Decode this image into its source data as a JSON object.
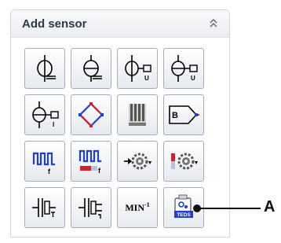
{
  "panel": {
    "title": "Add sensor"
  },
  "buttons": {
    "min_label": "MIN",
    "min_exp": "-1",
    "teds_label": "TEDS",
    "bridge_label": "B"
  },
  "icons": [
    "strain-gauge-icon",
    "strain-gauge-variant-icon",
    "voltage-sensor-icon",
    "voltage-sensor-variant-icon",
    "current-sensor-icon",
    "full-bridge-icon",
    "resistor-bank-icon",
    "bridge-amplifier-icon",
    "frequency-counter-icon",
    "frequency-counter-variant-icon",
    "rotary-encoder-icon",
    "rotary-encoder-variant-icon",
    "filter-icon",
    "filter-variant-icon",
    "rpm-sensor-icon",
    "teds-sensor-icon"
  ],
  "callout": {
    "label": "A"
  },
  "colors": {
    "accent_blue": "#1f3fd0",
    "accent_red": "#d4202a",
    "text": "#2b3a4a"
  }
}
